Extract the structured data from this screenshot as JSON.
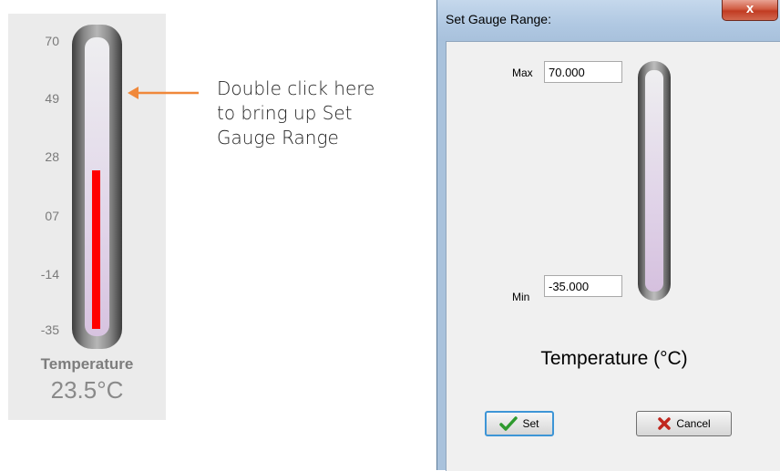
{
  "gauge": {
    "ticks": [
      "70",
      "49",
      "28",
      "07",
      "-14",
      "-35"
    ],
    "label": "Temperature",
    "value": "23.5°C",
    "range_min": -35,
    "range_max": 70,
    "current_value": 23.5,
    "fill_color": "#ff0000"
  },
  "annotation": {
    "lines": [
      "Double click here",
      "to bring up Set",
      "Gauge Range"
    ],
    "arrow_color": "#f0883a"
  },
  "dialog": {
    "title": "Set Gauge Range:",
    "close_label": "x",
    "max_label": "Max",
    "max_value": "70.000",
    "min_label": "Min",
    "min_value": "-35.000",
    "gauge_title": "Temperature (°C)",
    "set_label": "Set",
    "cancel_label": "Cancel"
  }
}
